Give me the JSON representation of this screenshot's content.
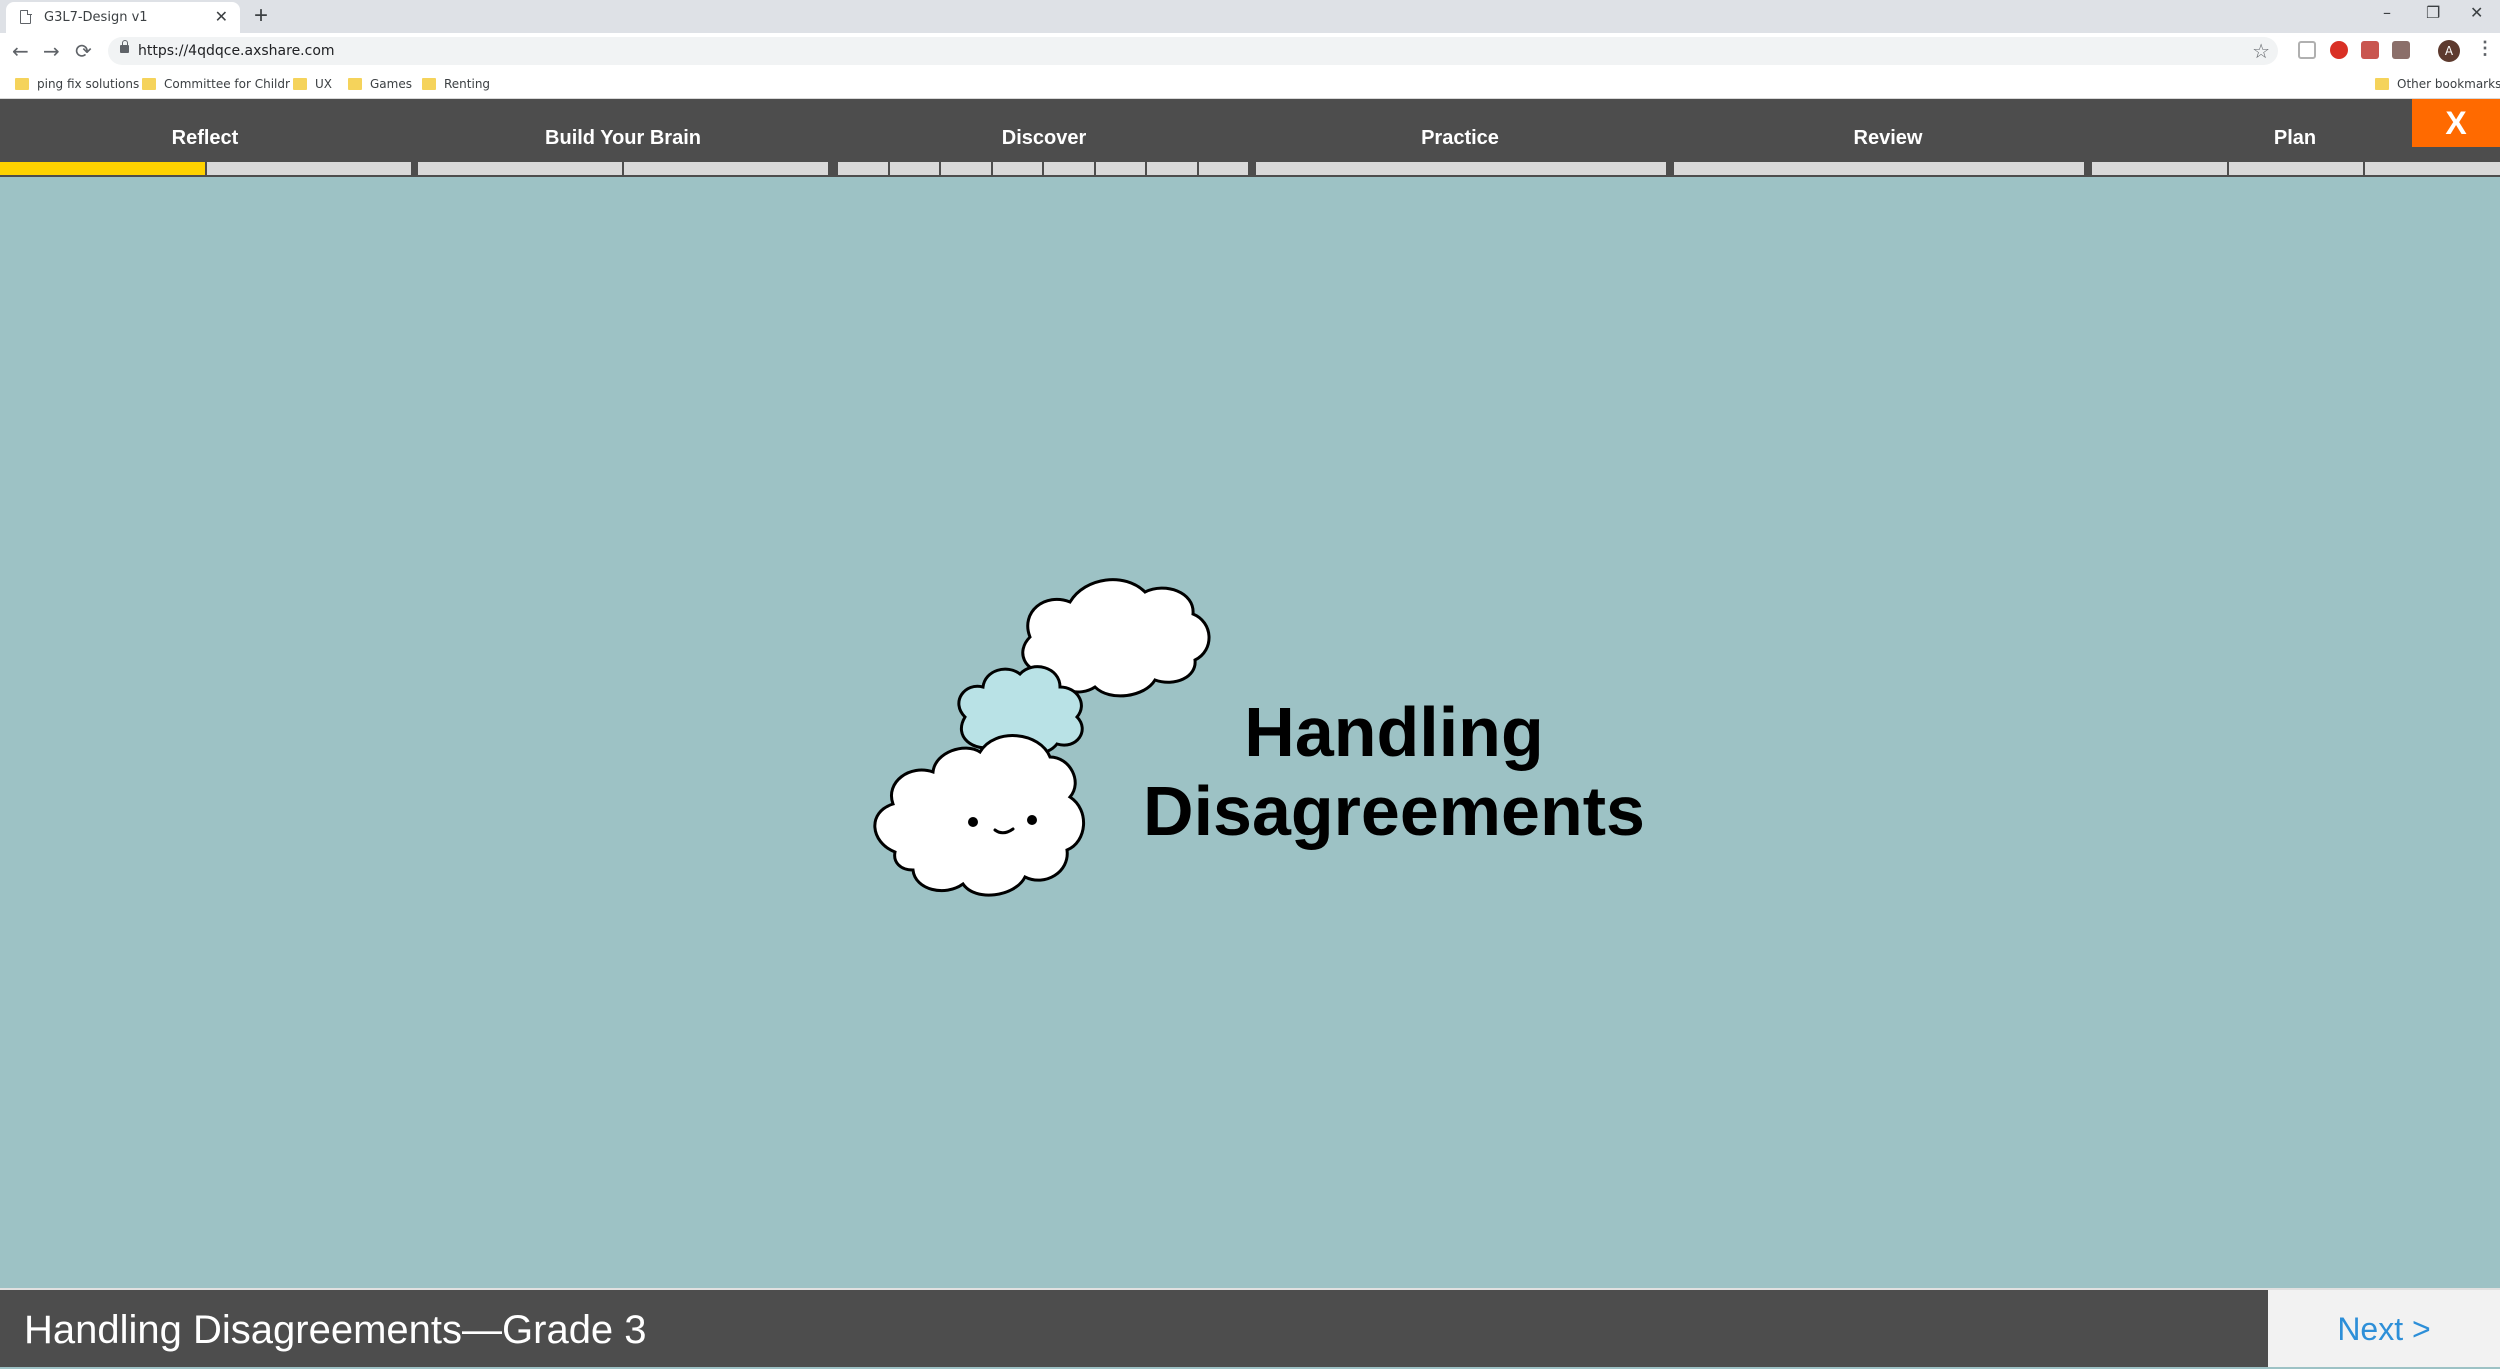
{
  "browser": {
    "tab_title": "G3L7-Design v1",
    "tab_close": "✕",
    "new_tab": "+",
    "url": "https://4qdqce.axshare.com",
    "window_controls": {
      "minimize": "–",
      "restore": "❐",
      "close": "✕"
    },
    "nav": {
      "back": "←",
      "forward": "→",
      "reload": "⟳"
    },
    "star": "☆",
    "avatar_letter": "A",
    "menu": "⋮",
    "bookmarks": [
      "ping fix solutions",
      "Committee for Childr",
      "UX",
      "Games",
      "Renting"
    ],
    "other_bookmarks": "Other bookmarks"
  },
  "app": {
    "nav_tabs": [
      {
        "label": "Reflect",
        "segments": 2,
        "active_segments": 1
      },
      {
        "label": "Build Your Brain",
        "segments": 2,
        "active_segments": 0
      },
      {
        "label": "Discover",
        "segments": 8,
        "active_segments": 0
      },
      {
        "label": "Practice",
        "segments": 1,
        "active_segments": 0
      },
      {
        "label": "Review",
        "segments": 1,
        "active_segments": 0
      },
      {
        "label": "Plan",
        "segments": 3,
        "active_segments": 0
      }
    ],
    "close_label": "X",
    "title_line1": "Handling",
    "title_line2": "Disagreements",
    "footer_title": "Handling Disagreements—Grade 3",
    "next_label": "Next >",
    "colors": {
      "nav_bg": "#4d4d4d",
      "stage_bg": "#9dc2c5",
      "progress_active": "#ffd200",
      "progress_inactive": "#d9d9d9",
      "close_bg": "#ff6a00",
      "next_text": "#2d8fd8",
      "small_cloud": "#b9e2e6"
    }
  }
}
